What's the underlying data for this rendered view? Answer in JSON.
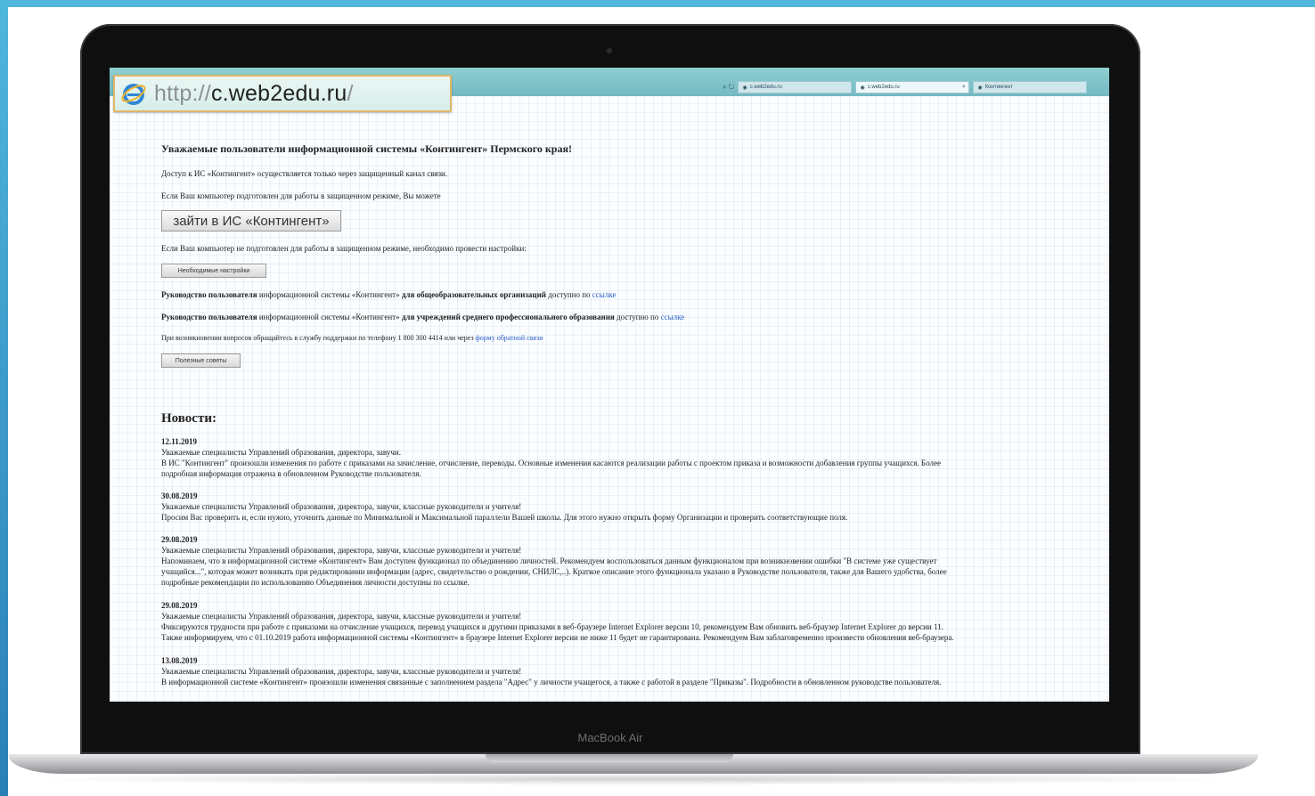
{
  "browser": {
    "address": {
      "protocol": "http://",
      "host": "c.web2edu.ru",
      "path": "/"
    },
    "tabs": [
      {
        "label": "c.web2edu.ru"
      },
      {
        "label": "c.web2edu.ru"
      },
      {
        "label": "Контингент"
      }
    ]
  },
  "page": {
    "title": "Уважаемые пользователи информационной системы «Контингент» Пермского края!",
    "access_text": "Доступ к ИС «Контингент» осуществляется только через защищенный канал связи.",
    "ready_text": "Если Ваш компьютер подготовлен для работы в защищенном режиме, Вы можете",
    "enter_button": "зайти в ИС «Контингент»",
    "not_ready_text": "Если Ваш компьютер не подготовлен для работы в защищенном режиме, необходимо провести настройки:",
    "settings_button": "Необходимые настройки",
    "guide1": {
      "bold": "Руководство пользователя",
      "mid": " информационной системы «Контингент» ",
      "bold2": "для общеобразовательных организаций",
      "tail": " доступно по ",
      "link": "ссылке"
    },
    "guide2": {
      "bold": "Руководство пользователя",
      "mid": " информационной системы «Контингент» ",
      "bold2": "для учреждений среднего профессионального образования",
      "tail": " доступно по ",
      "link": "ссылке"
    },
    "support_text": "При возникновении вопросов обращайтесь в службу поддержки по телефону 1 800 300 4414 или через ",
    "support_link": "форму обратной связи",
    "tips_button": "Полезные советы"
  },
  "news": {
    "heading": "Новости:",
    "items": [
      {
        "date": "12.11.2019",
        "lines": [
          "Уважаемые специалисты Управлений образования, директора, завучи.",
          "В ИС \"Контингент\" произошли изменения по работе с приказами на зачисление, отчисление, переводы. Основные изменения касаются реализации работы с проектом приказа и возможности добавления группы учащихся. Более",
          "подробная информация отражена в обновленном Руководстве пользователя."
        ]
      },
      {
        "date": "30.08.2019",
        "lines": [
          "Уважаемые специалисты Управлений образования, директора, завучи, классные руководители и учителя!",
          "Просим Вас проверить и, если нужно, уточнить данные по Минимальной и Максимальной параллели Вашей школы. Для этого нужно открыть форму Организации и проверить соответствующие поля."
        ]
      },
      {
        "date": "29.08.2019",
        "lines": [
          "Уважаемые специалисты Управлений образования, директора, завучи, классные руководители и учителя!",
          "Напоминаем, что в информационной системе «Контингент» Вам доступен функционал по объединению личностей. Рекомендуем воспользоваться данным функционалом при возникновении ошибки \"В системе уже существует",
          "учащийся...\", которая может возникать при редактировании информации (адрес, свидетельство о рождении, СНИЛС,..). Краткое описание этого функционала указано в Руководстве пользователя, также для Вашего удобства, более",
          "подробные рекомендации по использованию Объединения личности доступны по ссылке."
        ]
      },
      {
        "date": "29.08.2019",
        "lines": [
          "Уважаемые специалисты Управлений образования, директора, завучи, классные руководители и учителя!",
          "Фиксируются трудности при работе с приказами на отчисление учащихся, перевод учащихся и другими приказами в веб-браузере Internet Explorer версии 10, рекомендуем Вам обновить веб-браузер Internet Explorer до версии 11.",
          "Также информируем, что с 01.10.2019 работа информационной системы «Контингент» в браузере Internet Explorer версии не ниже 11 будет не гарантирована. Рекомендуем Вам заблаговременно произвести обновления веб-браузера."
        ]
      },
      {
        "date": "13.08.2019",
        "lines": [
          "Уважаемые специалисты Управлений образования, директора, завучи, классные руководители и учителя!",
          "В информационной системе «Контингент» произошли изменения связанные с заполнением раздела \"Адрес\" у личности учащегося, а также с работой в разделе \"Приказы\". Подробности в обновленном руководстве пользователя."
        ]
      }
    ]
  },
  "device": {
    "label": "MacBook Air"
  },
  "colors": {
    "frame_accent": "#4fb6dc",
    "browser_bar": "#8fcfd1",
    "link": "#2a60c8",
    "address_border": "#e0b76a"
  },
  "icons": {
    "browser": "internet-explorer-icon",
    "search": "search-icon",
    "refresh": "refresh-icon"
  }
}
